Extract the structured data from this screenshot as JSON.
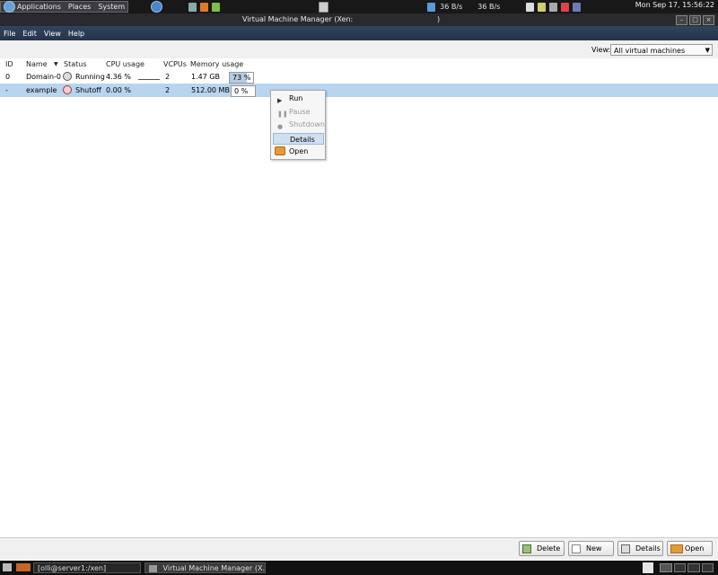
{
  "top_panel": {
    "menus": [
      "Applications",
      "Places",
      "System"
    ],
    "net_down": "36 B/s",
    "net_up": "36 B/s",
    "clock": "Mon Sep 17, 15:56:22"
  },
  "window": {
    "title": "Virtual Machine Manager (Xen:",
    "title_suffix": ")"
  },
  "menubar": {
    "file": "File",
    "edit": "Edit",
    "view": "View",
    "help": "Help"
  },
  "filter": {
    "label": "View:",
    "selected": "All virtual machines"
  },
  "columns": [
    "ID",
    "Name",
    "Status",
    "CPU usage",
    "VCPUs",
    "Memory usage"
  ],
  "vms": [
    {
      "id": "0",
      "name": "Domain-0",
      "status": "Running",
      "cpu": "4.36 %",
      "vcpus": "2",
      "memory": "1.47 GB",
      "mem_pct_label": "73 %",
      "mem_pct": 73
    },
    {
      "id": "-",
      "name": "example",
      "status": "Shutoff",
      "cpu": "0.00 %",
      "vcpus": "2",
      "memory": "512.00 MB",
      "mem_pct_label": "0 %",
      "mem_pct": 0
    }
  ],
  "context_menu": {
    "run": "Run",
    "pause": "Pause",
    "shutdown": "Shutdown",
    "details": "Details",
    "open": "Open"
  },
  "buttons": {
    "delete": "Delete",
    "new": "New",
    "details": "Details",
    "open": "Open"
  },
  "taskbar": {
    "terminal": "[olli@server1:/xen]",
    "vmm": "Virtual Machine Manager (X..."
  }
}
